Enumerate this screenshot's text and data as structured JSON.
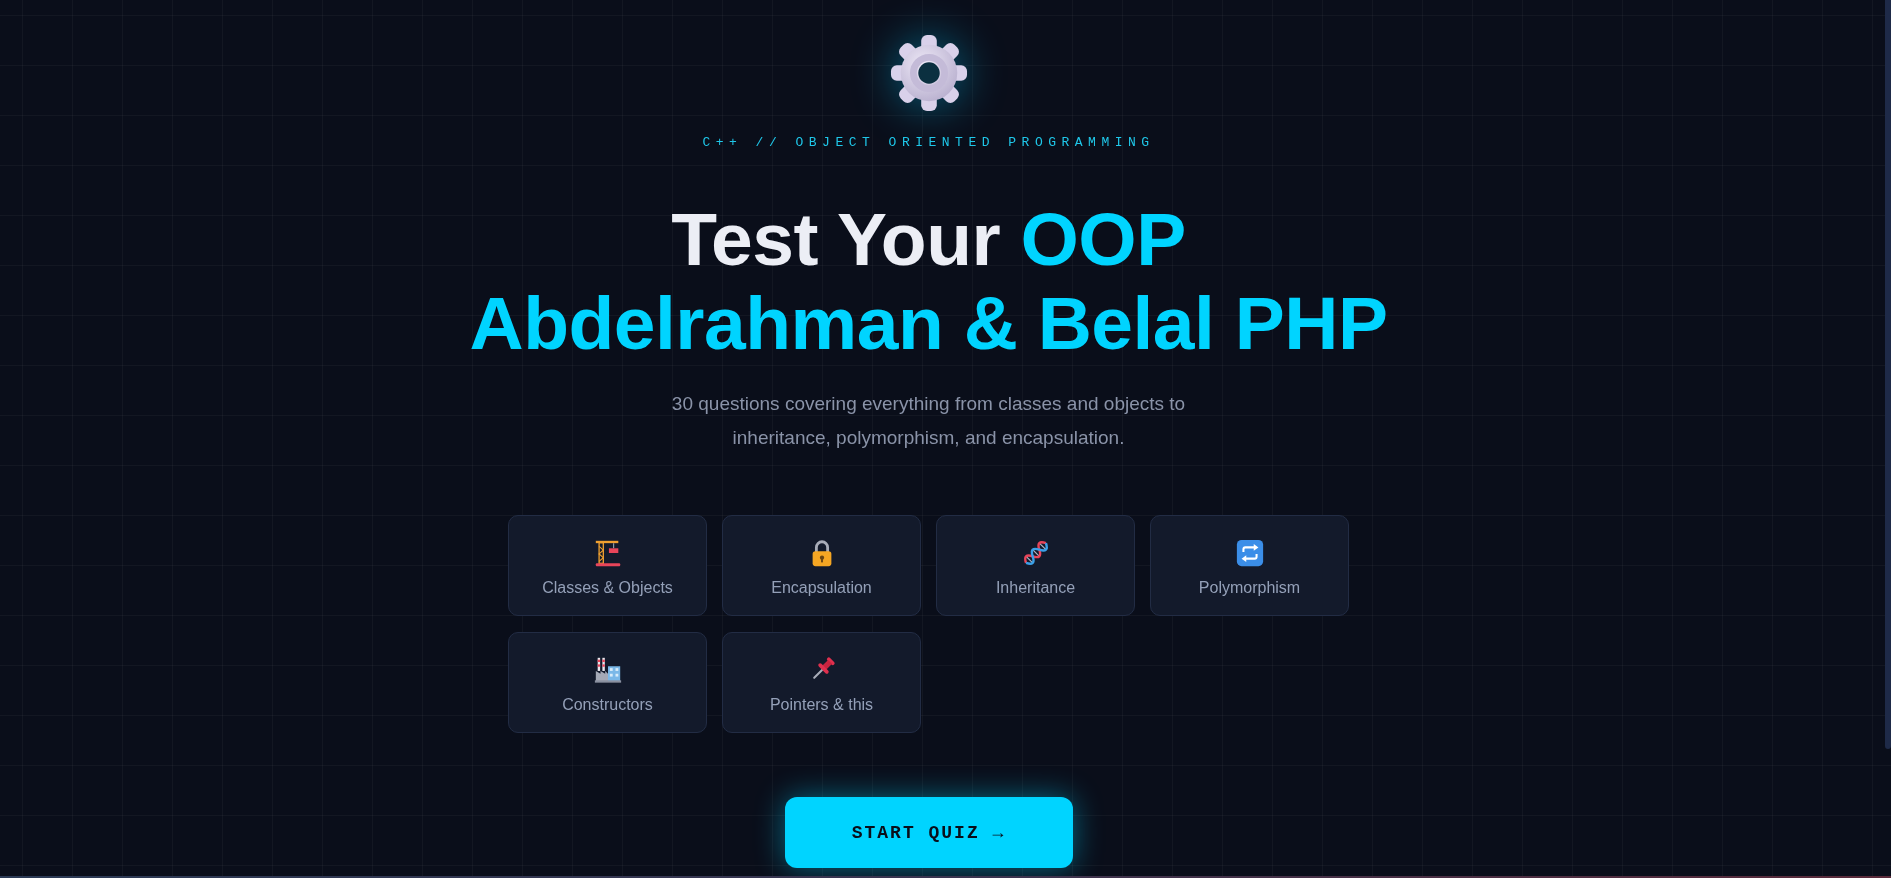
{
  "hero": {
    "eyebrow": "C++ // OBJECT ORIENTED PROGRAMMING",
    "title": {
      "lines": [
        [
          {
            "text": "Test Your",
            "color": "#eceef5"
          },
          {
            "text": "OOP",
            "color": "#00d4ff"
          }
        ],
        [
          {
            "text": "Abdelrahman & Belal PHP",
            "color": "#00d4ff"
          }
        ]
      ]
    },
    "description": "30 questions covering everything from classes and objects to inheritance, polymorphism, and encapsulation."
  },
  "topics": [
    {
      "label": "Classes & Objects"
    },
    {
      "label": "Encapsulation"
    },
    {
      "label": "Inheritance"
    },
    {
      "label": "Polymorphism"
    },
    {
      "label": "Constructors"
    },
    {
      "label": "Pointers & this"
    }
  ],
  "start_button": {
    "label": "START QUIZ →"
  }
}
